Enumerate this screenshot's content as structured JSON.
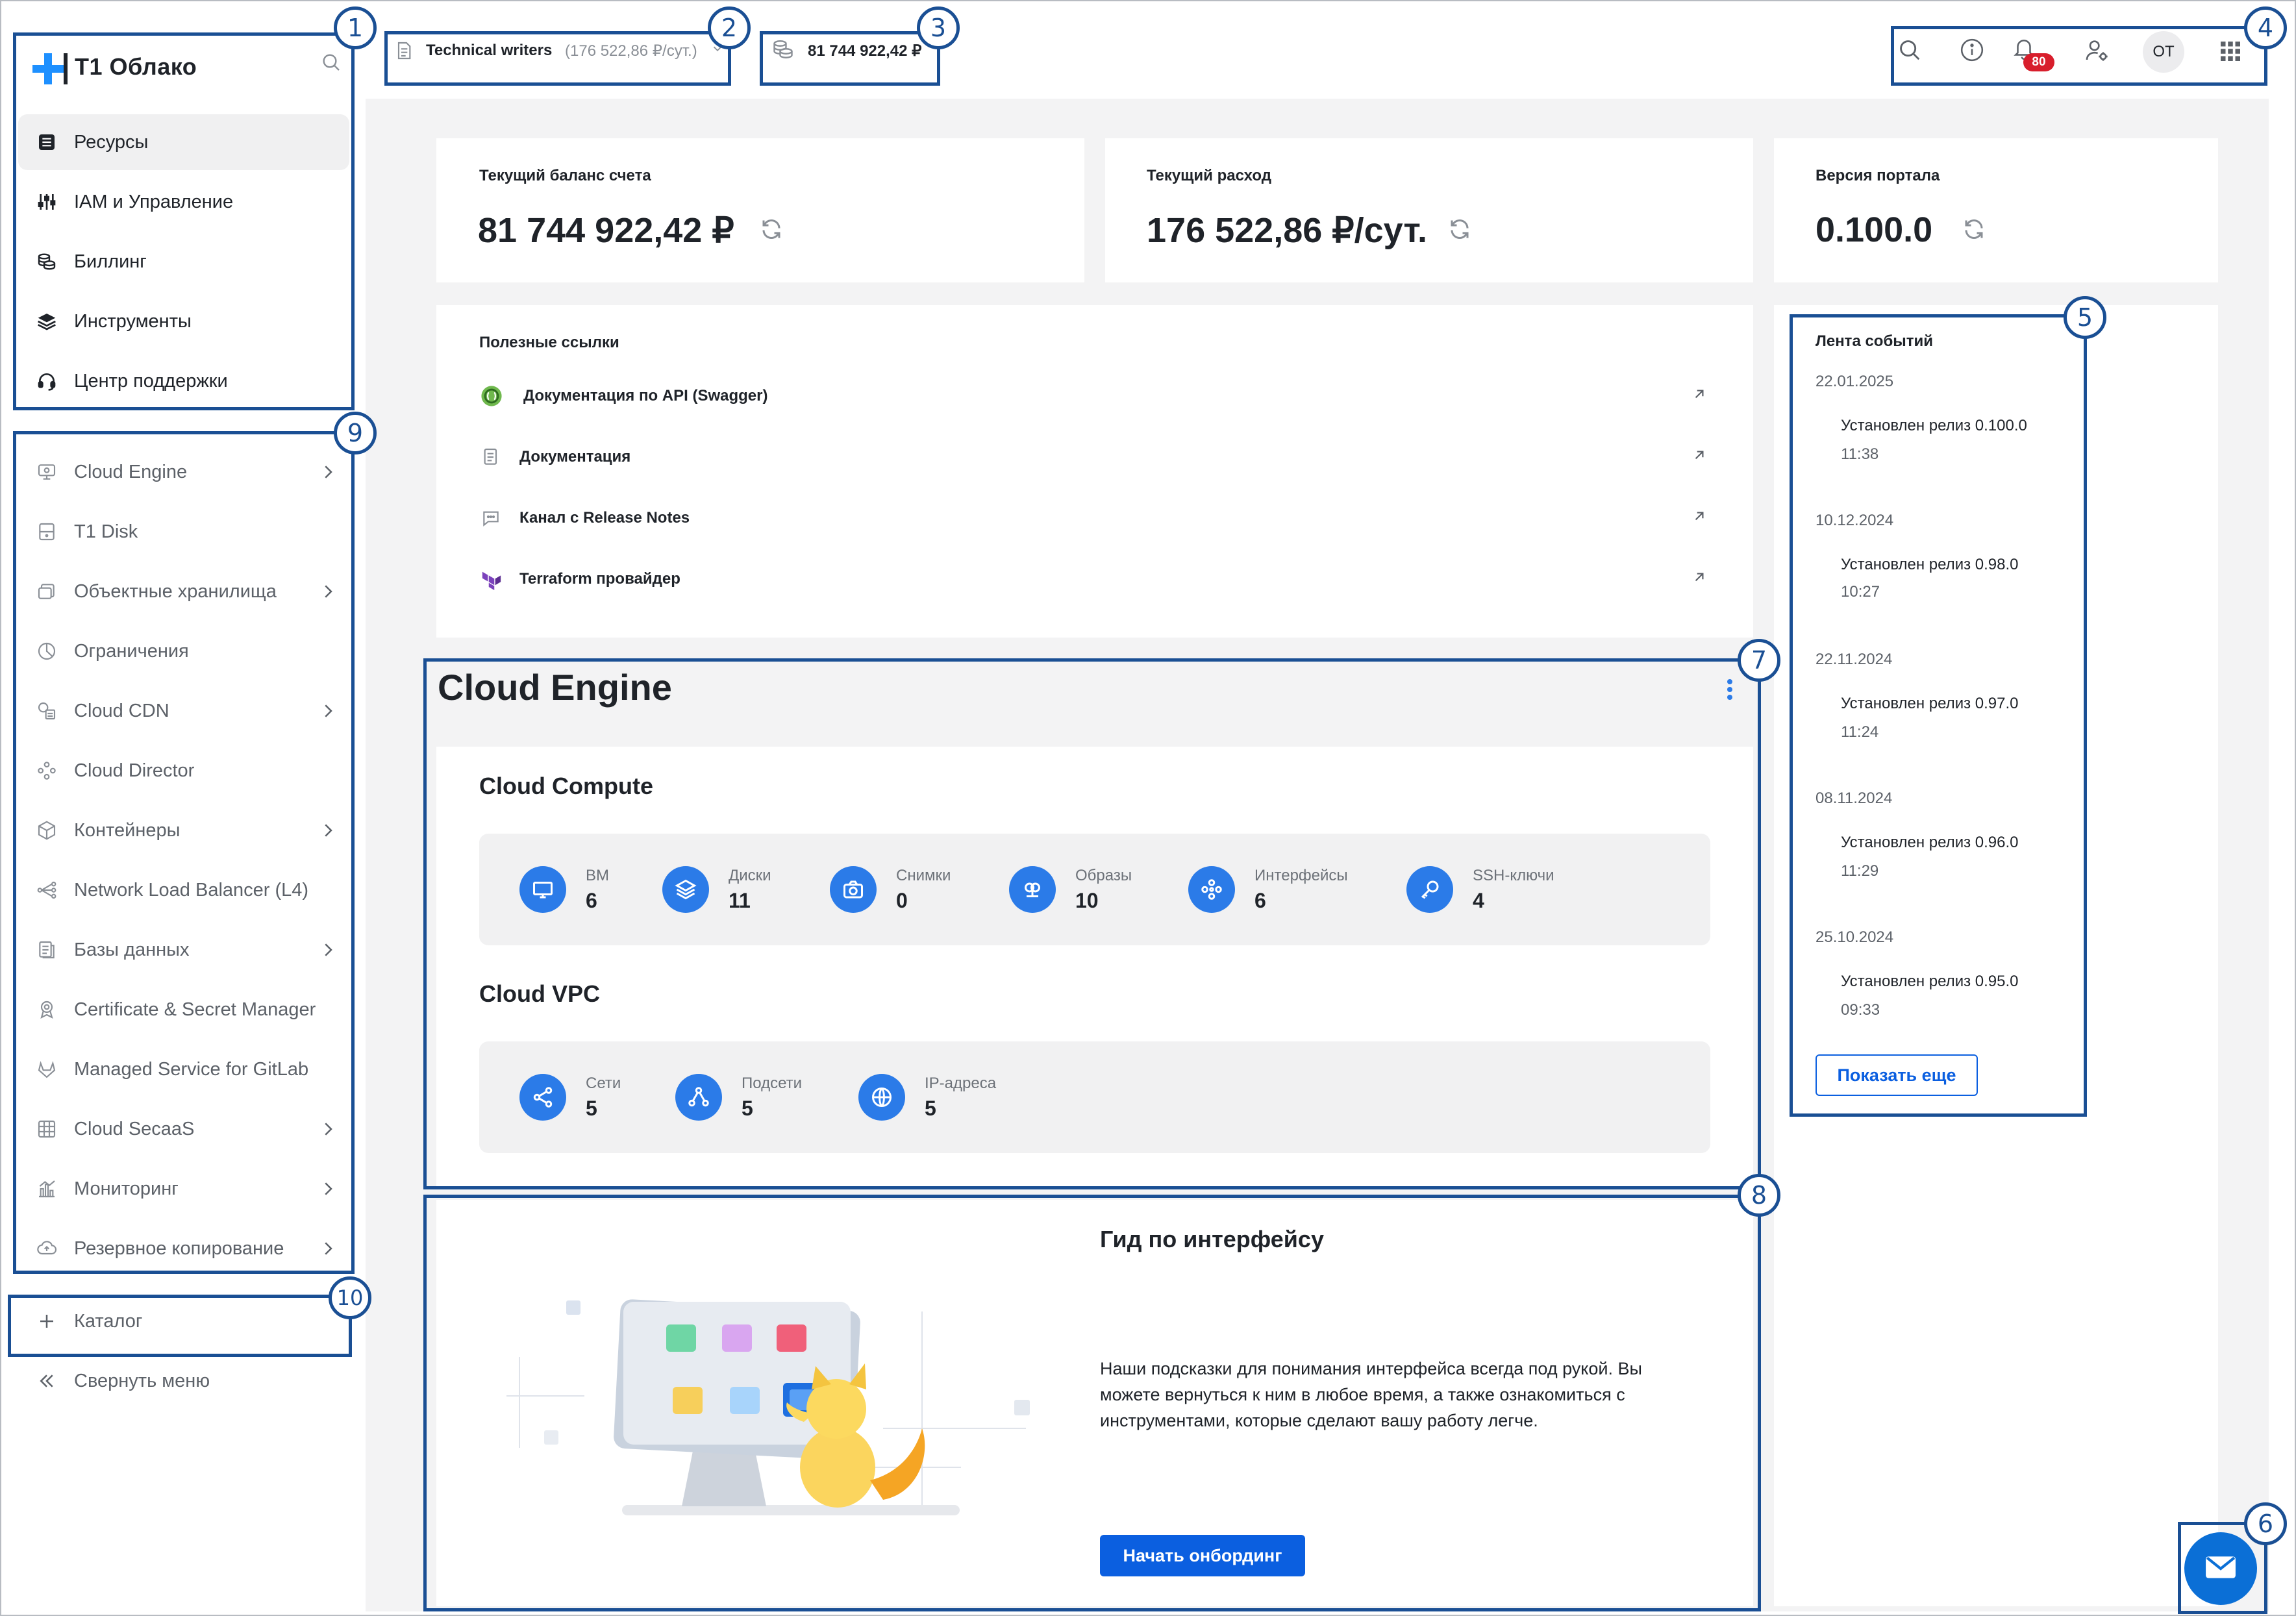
{
  "brand": {
    "name": "T1 Облако",
    "accent": "#1e90ff"
  },
  "header": {
    "project_name": "Technical writers",
    "project_rate": "(176 522,86 ₽/сут.)",
    "balance": "81 744 922,42 ₽",
    "notifications_count": "80",
    "user_initials": "OT"
  },
  "nav_main": [
    {
      "label": "Ресурсы",
      "icon": "resources-icon",
      "active": true
    },
    {
      "label": "IAM и Управление",
      "icon": "sliders-icon"
    },
    {
      "label": "Биллинг",
      "icon": "coins-icon"
    },
    {
      "label": "Инструменты",
      "icon": "layers-icon"
    },
    {
      "label": "Центр поддержки",
      "icon": "headset-icon"
    }
  ],
  "services": [
    {
      "label": "Cloud Engine",
      "icon": "server-icon",
      "chevron": true
    },
    {
      "label": "T1 Disk",
      "icon": "disk-icon",
      "chevron": false
    },
    {
      "label": "Объектные хранилища",
      "icon": "storage-icon",
      "chevron": true
    },
    {
      "label": "Ограничения",
      "icon": "pie-icon",
      "chevron": false
    },
    {
      "label": "Cloud CDN",
      "icon": "cdn-icon",
      "chevron": true
    },
    {
      "label": "Cloud Director",
      "icon": "director-icon",
      "chevron": false
    },
    {
      "label": "Контейнеры",
      "icon": "cube-icon",
      "chevron": true
    },
    {
      "label": "Network Load Balancer (L4)",
      "icon": "balancer-icon",
      "chevron": false
    },
    {
      "label": "Базы данных",
      "icon": "database-icon",
      "chevron": true
    },
    {
      "label": "Certificate & Secret Manager",
      "icon": "certificate-icon",
      "chevron": false
    },
    {
      "label": "Managed Service for GitLab",
      "icon": "gitlab-icon",
      "chevron": false
    },
    {
      "label": "Cloud SecaaS",
      "icon": "secaas-icon",
      "chevron": true
    },
    {
      "label": "Мониторинг",
      "icon": "chart-icon",
      "chevron": true
    },
    {
      "label": "Резервное копирование",
      "icon": "backup-icon",
      "chevron": true
    }
  ],
  "catalog_label": "Каталог",
  "collapse_label": "Свернуть меню",
  "stats": {
    "balance_label": "Текущий баланс счета",
    "balance_value": "81 744 922,42 ₽",
    "spend_label": "Текущий расход",
    "spend_value": "176 522,86 ₽/сут.",
    "version_label": "Версия портала",
    "version_value": "0.100.0"
  },
  "links": {
    "title": "Полезные ссылки",
    "items": [
      {
        "label": "Документация по API (Swagger)"
      },
      {
        "label": "Документация"
      },
      {
        "label": "Канал с Release Notes"
      },
      {
        "label": "Terraform провайдер"
      }
    ]
  },
  "cloud_engine": {
    "title": "Cloud Engine",
    "compute_title": "Cloud Compute",
    "compute": [
      {
        "label": "ВМ",
        "value": "6",
        "icon": "monitor-icon"
      },
      {
        "label": "Диски",
        "value": "11",
        "icon": "layers-icon"
      },
      {
        "label": "Снимки",
        "value": "0",
        "icon": "camera-icon"
      },
      {
        "label": "Образы",
        "value": "10",
        "icon": "image-icon"
      },
      {
        "label": "Интерфейсы",
        "value": "6",
        "icon": "interface-icon"
      },
      {
        "label": "SSH-ключи",
        "value": "4",
        "icon": "key-icon"
      }
    ],
    "vpc_title": "Cloud VPC",
    "vpc": [
      {
        "label": "Сети",
        "value": "5",
        "icon": "share-icon"
      },
      {
        "label": "Подсети",
        "value": "5",
        "icon": "subnet-icon"
      },
      {
        "label": "IP-адреса",
        "value": "5",
        "icon": "globe-icon"
      }
    ]
  },
  "guide": {
    "title": "Гид по интерфейсу",
    "text": "Наши подсказки для понимания интерфейса всегда под рукой. Вы можете вернуться к ним в любое время, а также ознакомиться с инструментами, которые сделают вашу работу легче.",
    "button": "Начать онбординг"
  },
  "events": {
    "title": "Лента событий",
    "items": [
      {
        "date": "22.01.2025",
        "text": "Установлен релиз 0.100.0",
        "time": "11:38"
      },
      {
        "date": "10.12.2024",
        "text": "Установлен релиз 0.98.0",
        "time": "10:27"
      },
      {
        "date": "22.11.2024",
        "text": "Установлен релиз 0.97.0",
        "time": "11:24"
      },
      {
        "date": "08.11.2024",
        "text": "Установлен релиз 0.96.0",
        "time": "11:29"
      },
      {
        "date": "25.10.2024",
        "text": "Установлен релиз 0.95.0",
        "time": "09:33"
      }
    ],
    "more_button": "Показать еще"
  },
  "annotations": [
    "1",
    "2",
    "3",
    "4",
    "5",
    "6",
    "7",
    "8",
    "9",
    "10"
  ]
}
